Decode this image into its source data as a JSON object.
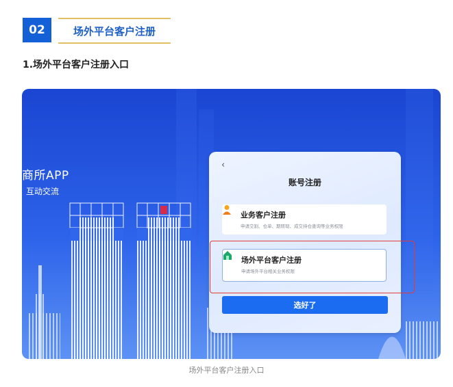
{
  "section": {
    "number": "02",
    "title": "场外平台客户注册"
  },
  "subheading": "1.场外平台客户注册入口",
  "screenshot": {
    "app_name": "商所APP",
    "app_subtitle": "互动交流",
    "panel": {
      "back_glyph": "‹",
      "title": "账号注册",
      "options": [
        {
          "title": "业务客户注册",
          "desc": "申请交割、仓单、期转现、成交持仓查询等业务权限",
          "icon": "person-icon"
        },
        {
          "title": "场外平台客户注册",
          "desc": "申请场外平台相关业务权限",
          "icon": "house-icon"
        }
      ],
      "confirm_label": "选好了"
    },
    "highlight_color": "#e23b3b"
  },
  "caption": "场外平台客户注册入口",
  "colors": {
    "accent": "#1460d6",
    "gold": "#e2bf63",
    "button": "#1c6cf2"
  }
}
